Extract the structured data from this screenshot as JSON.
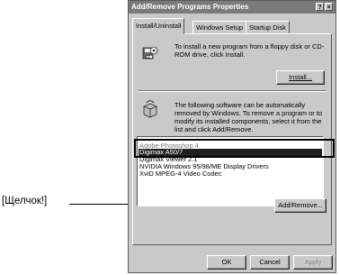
{
  "callout": {
    "text": "[Щелчок!]"
  },
  "dialog": {
    "title": "Add/Remove Programs Properties",
    "help_glyph": "?",
    "close_glyph": "×",
    "tabs": [
      {
        "label": "Install/Uninstall",
        "active": true
      },
      {
        "label": "Windows Setup"
      },
      {
        "label": "Startup Disk"
      }
    ],
    "install_text": "To install a new program from a floppy disk or CD-ROM drive, click Install.",
    "install_button": "Install...",
    "remove_text": "The following software can be automatically removed by Windows. To remove a program or to modify its installed components, select it from the list and click Add/Remove.",
    "programs": [
      "Adobe Photoshop 4",
      "Digimax A50/7",
      "Digimax Viewer 2.1",
      "NVIDIA Windows 95/98/ME Display Drivers",
      "XviD MPEG-4 Video Codec"
    ],
    "selected_program_index": 1,
    "add_remove_button": "Add/Remove...",
    "ok_button": "OK",
    "cancel_button": "Cancel",
    "apply_button": "Apply"
  },
  "colors": {
    "title_bar": "#7a7a7a",
    "dialog_face": "#c9c9c9",
    "selection": "#202020"
  }
}
